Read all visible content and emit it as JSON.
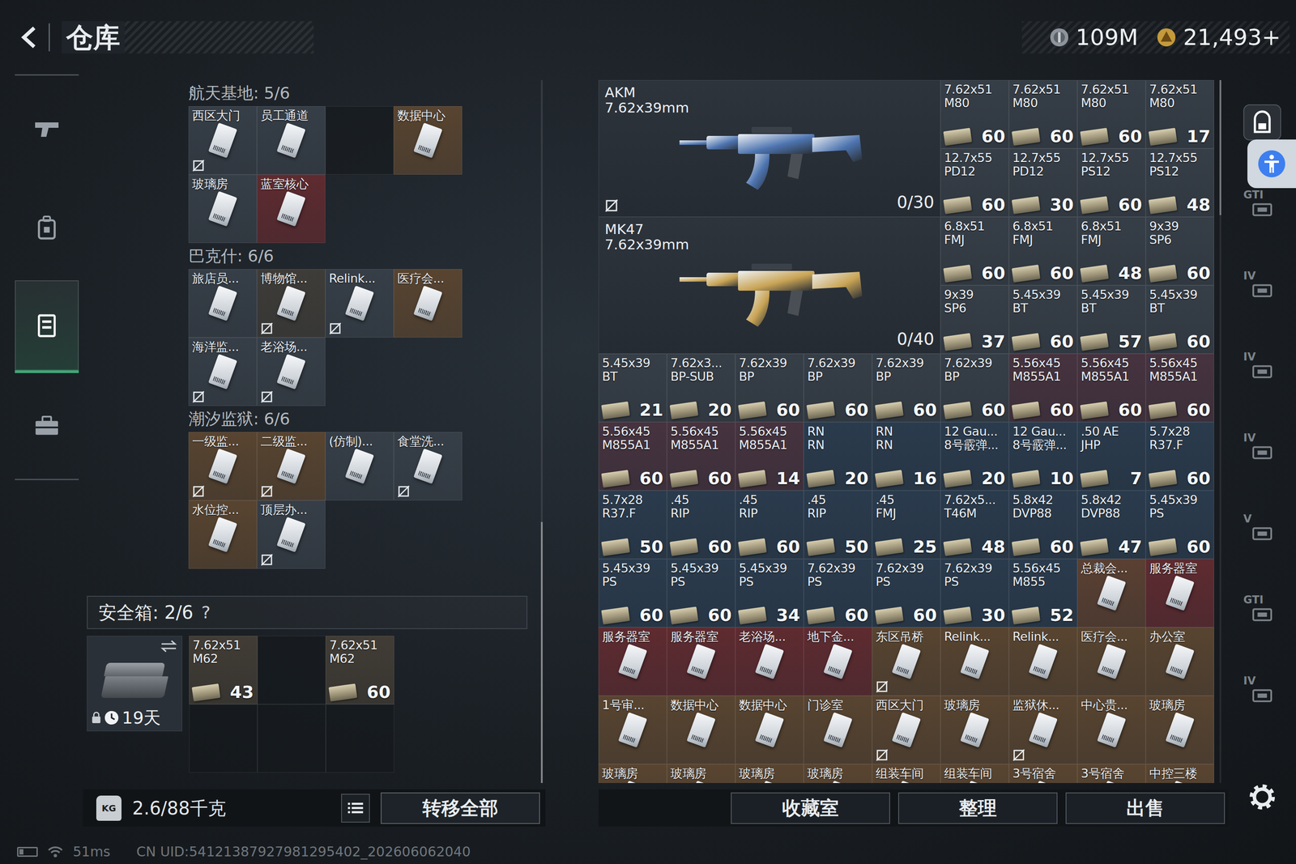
{
  "header": {
    "title": "仓库",
    "currencies": [
      {
        "kind": "coin",
        "amount": "109M"
      },
      {
        "kind": "token",
        "amount": "21,493+"
      }
    ]
  },
  "sidebar": {
    "items": [
      {
        "kind": "weapon",
        "selected": false
      },
      {
        "kind": "gear",
        "selected": false
      },
      {
        "kind": "storage",
        "selected": true
      },
      {
        "kind": "case",
        "selected": false
      }
    ]
  },
  "keyGroups": [
    {
      "title": "航天基地: 5/6",
      "slots": [
        {
          "kind": "key",
          "label": "西区大门",
          "color": "#363e47",
          "unbound": true
        },
        {
          "kind": "key",
          "label": "员工通道",
          "color": "#363e47",
          "unbound": false
        },
        {
          "kind": "empty"
        },
        {
          "kind": "key",
          "label": "数据中心",
          "color": "#584430",
          "unbound": false
        },
        {
          "kind": "key",
          "label": "玻璃房",
          "color": "#363e47",
          "unbound": false
        },
        {
          "kind": "key",
          "label": "蓝室核心",
          "color": "#5e2b30",
          "unbound": false
        }
      ]
    },
    {
      "title": "巴克什: 6/6",
      "slots": [
        {
          "kind": "key",
          "label": "旅店员...",
          "color": "#363e47",
          "unbound": false
        },
        {
          "kind": "key",
          "label": "博物馆...",
          "color": "#3e3c38",
          "unbound": true
        },
        {
          "kind": "key",
          "label": "Relink...",
          "color": "#363e47",
          "unbound": true
        },
        {
          "kind": "key",
          "label": "医疗会...",
          "color": "#584430",
          "unbound": false
        },
        {
          "kind": "key",
          "label": "海洋监...",
          "color": "#363e47",
          "unbound": true
        },
        {
          "kind": "key",
          "label": "老浴场...",
          "color": "#363e47",
          "unbound": true
        }
      ]
    },
    {
      "title": "潮汐监狱: 6/6",
      "slots": [
        {
          "kind": "key",
          "label": "一级监...",
          "color": "#584430",
          "unbound": true
        },
        {
          "kind": "key",
          "label": "二级监...",
          "color": "#584430",
          "unbound": true
        },
        {
          "kind": "key",
          "label": "(仿制)...",
          "color": "#363e47",
          "unbound": false
        },
        {
          "kind": "key",
          "label": "食堂洗...",
          "color": "#363e47",
          "unbound": true
        },
        {
          "kind": "key",
          "label": "水位控...",
          "color": "#584430",
          "unbound": false
        },
        {
          "kind": "key",
          "label": "顶层办...",
          "color": "#363e47",
          "unbound": true
        }
      ]
    }
  ],
  "safeBox": {
    "title": "安全箱: 2/6",
    "help": "?",
    "days": "19天",
    "slots": [
      {
        "kind": "ammo",
        "name": "7.62x51",
        "type": "M62",
        "count": "43",
        "color": "#413c35",
        "unbound": false
      },
      {
        "kind": "empty"
      },
      {
        "kind": "ammo",
        "name": "7.62x51",
        "type": "M62",
        "count": "60",
        "color": "#413c35",
        "unbound": false
      },
      {
        "kind": "empty"
      },
      {
        "kind": "empty"
      },
      {
        "kind": "empty"
      }
    ]
  },
  "weight": {
    "icon": "KG",
    "text": "2.6/88千克"
  },
  "transferButton": "转移全部",
  "stash": {
    "cells": [
      {
        "kind": "weapon",
        "name": "AKM",
        "caliber": "7.62x39mm",
        "ammo": "0/30",
        "color": "#4d74b0",
        "unbound": true
      },
      {
        "kind": "ammo",
        "name": "7.62x51",
        "type": "M80",
        "count": "60",
        "color": "#363e47",
        "unbound": false
      },
      {
        "kind": "ammo",
        "name": "7.62x51",
        "type": "M80",
        "count": "60",
        "color": "#363e47",
        "unbound": false
      },
      {
        "kind": "ammo",
        "name": "7.62x51",
        "type": "M80",
        "count": "60",
        "color": "#363e47",
        "unbound": false
      },
      {
        "kind": "ammo",
        "name": "7.62x51",
        "type": "M80",
        "count": "17",
        "color": "#363e47",
        "unbound": false
      },
      {
        "kind": "ammo",
        "name": "12.7x55",
        "type": "PD12",
        "count": "60",
        "color": "#363e47",
        "unbound": false
      },
      {
        "kind": "ammo",
        "name": "12.7x55",
        "type": "PD12",
        "count": "30",
        "color": "#363e47",
        "unbound": false
      },
      {
        "kind": "ammo",
        "name": "12.7x55",
        "type": "PS12",
        "count": "60",
        "color": "#363e47",
        "unbound": false
      },
      {
        "kind": "ammo",
        "name": "12.7x55",
        "type": "PS12",
        "count": "48",
        "color": "#363e47",
        "unbound": false
      },
      {
        "kind": "weapon",
        "name": "MK47",
        "caliber": "7.62x39mm",
        "ammo": "0/40",
        "color": "#c9a455",
        "unbound": false
      },
      {
        "kind": "ammo",
        "name": "6.8x51",
        "type": "FMJ",
        "count": "60",
        "color": "#363e47",
        "unbound": false
      },
      {
        "kind": "ammo",
        "name": "6.8x51",
        "type": "FMJ",
        "count": "60",
        "color": "#363e47",
        "unbound": false
      },
      {
        "kind": "ammo",
        "name": "6.8x51",
        "type": "FMJ",
        "count": "48",
        "color": "#363e47",
        "unbound": false
      },
      {
        "kind": "ammo",
        "name": "9x39",
        "type": "SP6",
        "count": "60",
        "color": "#363e47",
        "unbound": false
      },
      {
        "kind": "ammo",
        "name": "9x39",
        "type": "SP6",
        "count": "37",
        "color": "#363e47",
        "unbound": false
      },
      {
        "kind": "ammo",
        "name": "5.45x39",
        "type": "BT",
        "count": "60",
        "color": "#363e47",
        "unbound": false
      },
      {
        "kind": "ammo",
        "name": "5.45x39",
        "type": "BT",
        "count": "57",
        "color": "#363e47",
        "unbound": false
      },
      {
        "kind": "ammo",
        "name": "5.45x39",
        "type": "BT",
        "count": "60",
        "color": "#363e47",
        "unbound": false
      },
      {
        "kind": "ammo",
        "name": "5.45x39",
        "type": "BT",
        "count": "21",
        "color": "#363e47",
        "unbound": false
      },
      {
        "kind": "ammo",
        "name": "7.62x3...",
        "type": "BP-SUB",
        "count": "20",
        "color": "#363e47",
        "unbound": false
      },
      {
        "kind": "ammo",
        "name": "7.62x39",
        "type": "BP",
        "count": "60",
        "color": "#363e47",
        "unbound": false
      },
      {
        "kind": "ammo",
        "name": "7.62x39",
        "type": "BP",
        "count": "60",
        "color": "#363e47",
        "unbound": false
      },
      {
        "kind": "ammo",
        "name": "7.62x39",
        "type": "BP",
        "count": "60",
        "color": "#363e47",
        "unbound": false
      },
      {
        "kind": "ammo",
        "name": "7.62x39",
        "type": "BP",
        "count": "60",
        "color": "#363e47",
        "unbound": false
      },
      {
        "kind": "ammo",
        "name": "5.56x45",
        "type": "M855A1",
        "count": "60",
        "color": "#46333f",
        "unbound": false
      },
      {
        "kind": "ammo",
        "name": "5.56x45",
        "type": "M855A1",
        "count": "60",
        "color": "#46333f",
        "unbound": false
      },
      {
        "kind": "ammo",
        "name": "5.56x45",
        "type": "M855A1",
        "count": "60",
        "color": "#46333f",
        "unbound": false
      },
      {
        "kind": "ammo",
        "name": "5.56x45",
        "type": "M855A1",
        "count": "60",
        "color": "#46333f",
        "unbound": false
      },
      {
        "kind": "ammo",
        "name": "5.56x45",
        "type": "M855A1",
        "count": "60",
        "color": "#46333f",
        "unbound": false
      },
      {
        "kind": "ammo",
        "name": "5.56x45",
        "type": "M855A1",
        "count": "14",
        "color": "#46333f",
        "unbound": false
      },
      {
        "kind": "ammo",
        "name": "RN",
        "type": "RN",
        "count": "20",
        "color": "#2a3b4d",
        "unbound": false
      },
      {
        "kind": "ammo",
        "name": "RN",
        "type": "RN",
        "count": "16",
        "color": "#2a3b4d",
        "unbound": false
      },
      {
        "kind": "ammo",
        "name": "12 Gau...",
        "type": "8号霰弹...",
        "count": "20",
        "color": "#2a3b4d",
        "unbound": false
      },
      {
        "kind": "ammo",
        "name": "12 Gau...",
        "type": "8号霰弹...",
        "count": "10",
        "color": "#2a3b4d",
        "unbound": false
      },
      {
        "kind": "ammo",
        "name": ".50 AE",
        "type": "JHP",
        "count": "7",
        "color": "#2a3b4d",
        "unbound": false
      },
      {
        "kind": "ammo",
        "name": "5.7x28",
        "type": "R37.F",
        "count": "60",
        "color": "#2a3b4d",
        "unbound": false
      },
      {
        "kind": "ammo",
        "name": "5.7x28",
        "type": "R37.F",
        "count": "50",
        "color": "#2a3b4d",
        "unbound": false
      },
      {
        "kind": "ammo",
        "name": ".45",
        "type": "RIP",
        "count": "60",
        "color": "#2a3b4d",
        "unbound": false
      },
      {
        "kind": "ammo",
        "name": ".45",
        "type": "RIP",
        "count": "60",
        "color": "#2a3b4d",
        "unbound": false
      },
      {
        "kind": "ammo",
        "name": ".45",
        "type": "RIP",
        "count": "50",
        "color": "#2a3b4d",
        "unbound": false
      },
      {
        "kind": "ammo",
        "name": ".45",
        "type": "FMJ",
        "count": "25",
        "color": "#2a3b4d",
        "unbound": false
      },
      {
        "kind": "ammo",
        "name": "7.62x5...",
        "type": "T46M",
        "count": "48",
        "color": "#2a3b4d",
        "unbound": false
      },
      {
        "kind": "ammo",
        "name": "5.8x42",
        "type": "DVP88",
        "count": "60",
        "color": "#2a3b4d",
        "unbound": false
      },
      {
        "kind": "ammo",
        "name": "5.8x42",
        "type": "DVP88",
        "count": "47",
        "color": "#2a3b4d",
        "unbound": false
      },
      {
        "kind": "ammo",
        "name": "5.45x39",
        "type": "PS",
        "count": "60",
        "color": "#2a3b4d",
        "unbound": false
      },
      {
        "kind": "ammo",
        "name": "5.45x39",
        "type": "PS",
        "count": "60",
        "color": "#2a3b4d",
        "unbound": false
      },
      {
        "kind": "ammo",
        "name": "5.45x39",
        "type": "PS",
        "count": "60",
        "color": "#2a3b4d",
        "unbound": false
      },
      {
        "kind": "ammo",
        "name": "5.45x39",
        "type": "PS",
        "count": "34",
        "color": "#2a3b4d",
        "unbound": false
      },
      {
        "kind": "ammo",
        "name": "7.62x39",
        "type": "PS",
        "count": "60",
        "color": "#2a3b4d",
        "unbound": false
      },
      {
        "kind": "ammo",
        "name": "7.62x39",
        "type": "PS",
        "count": "60",
        "color": "#2a3b4d",
        "unbound": false
      },
      {
        "kind": "ammo",
        "name": "7.62x39",
        "type": "PS",
        "count": "30",
        "color": "#2a3b4d",
        "unbound": false
      },
      {
        "kind": "ammo",
        "name": "5.56x45",
        "type": "M855",
        "count": "52",
        "color": "#2a3b4d",
        "unbound": false
      },
      {
        "kind": "key",
        "label": "总裁会...",
        "color": "#5a4032",
        "unbound": false
      },
      {
        "kind": "key",
        "label": "服务器室",
        "color": "#5e2b30",
        "unbound": false
      },
      {
        "kind": "key",
        "label": "服务器室",
        "color": "#5e2b30",
        "unbound": false
      },
      {
        "kind": "key",
        "label": "服务器室",
        "color": "#5e2b30",
        "unbound": false
      },
      {
        "kind": "key",
        "label": "老浴场...",
        "color": "#5e2b30",
        "unbound": false
      },
      {
        "kind": "key",
        "label": "地下金...",
        "color": "#5e2b30",
        "unbound": false
      },
      {
        "kind": "key",
        "label": "东区吊桥",
        "color": "#584430",
        "unbound": true
      },
      {
        "kind": "key",
        "label": "Relink...",
        "color": "#584430",
        "unbound": false
      },
      {
        "kind": "key",
        "label": "Relink...",
        "color": "#584430",
        "unbound": false
      },
      {
        "kind": "key",
        "label": "医疗会...",
        "color": "#584430",
        "unbound": false
      },
      {
        "kind": "key",
        "label": "办公室",
        "color": "#584430",
        "unbound": false
      },
      {
        "kind": "key",
        "label": "1号审...",
        "color": "#584430",
        "unbound": false
      },
      {
        "kind": "key",
        "label": "数据中心",
        "color": "#584430",
        "unbound": false
      },
      {
        "kind": "key",
        "label": "数据中心",
        "color": "#584430",
        "unbound": false
      },
      {
        "kind": "key",
        "label": "门诊室",
        "color": "#584430",
        "unbound": false
      },
      {
        "kind": "key",
        "label": "西区大门",
        "color": "#584430",
        "unbound": true
      },
      {
        "kind": "key",
        "label": "玻璃房",
        "color": "#584430",
        "unbound": false
      },
      {
        "kind": "key",
        "label": "监狱休...",
        "color": "#584430",
        "unbound": true
      },
      {
        "kind": "key",
        "label": "中心贵...",
        "color": "#584430",
        "unbound": false
      },
      {
        "kind": "key",
        "label": "玻璃房",
        "color": "#584430",
        "unbound": false
      },
      {
        "kind": "key",
        "label": "玻璃房",
        "color": "#584430",
        "unbound": false
      },
      {
        "kind": "key",
        "label": "玻璃房",
        "color": "#584430",
        "unbound": false
      },
      {
        "kind": "key",
        "label": "玻璃房",
        "color": "#584430",
        "unbound": false
      },
      {
        "kind": "key",
        "label": "玻璃房",
        "color": "#584430",
        "unbound": false
      },
      {
        "kind": "key",
        "label": "组装车间",
        "color": "#584430",
        "unbound": false
      },
      {
        "kind": "key",
        "label": "组装车间",
        "color": "#584430",
        "unbound": false
      },
      {
        "kind": "key",
        "label": "3号宿舍",
        "color": "#584430",
        "unbound": false
      },
      {
        "kind": "key",
        "label": "3号宿舍",
        "color": "#584430",
        "unbound": false
      },
      {
        "kind": "key",
        "label": "中控三楼",
        "color": "#584430",
        "unbound": false
      }
    ]
  },
  "actions": [
    {
      "label": "收藏室"
    },
    {
      "label": "整理"
    },
    {
      "label": "出售"
    }
  ],
  "tools": [
    {
      "kind": "save",
      "label": "",
      "selected": true
    },
    {
      "kind": "tier",
      "label": "GTI",
      "selected": false
    },
    {
      "kind": "tier",
      "label": "IV",
      "selected": false
    },
    {
      "kind": "tier",
      "label": "IV",
      "selected": false
    },
    {
      "kind": "tier",
      "label": "IV",
      "selected": false
    },
    {
      "kind": "tier",
      "label": "V",
      "selected": false
    },
    {
      "kind": "tier",
      "label": "GTI",
      "selected": false
    },
    {
      "kind": "tier",
      "label": "IV",
      "selected": false
    }
  ],
  "status": {
    "battery": {
      "level": 0.25
    },
    "ping": "51ms",
    "uid": "CN UID:54121387927981295402_202606062040"
  }
}
